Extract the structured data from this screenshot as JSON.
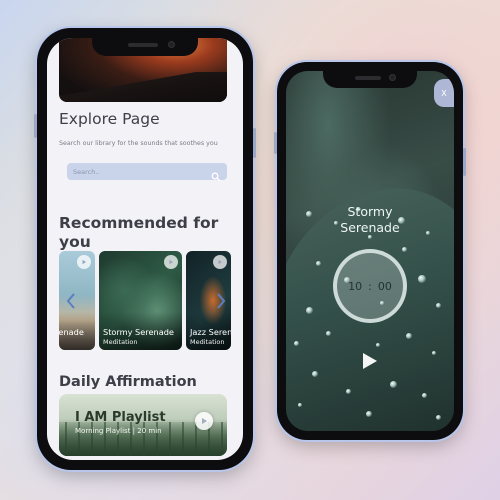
{
  "explore": {
    "title": "Explore Page",
    "subtitle": "Search our library for the sounds that soothes you",
    "search_placeholder": "Search.."
  },
  "recommended": {
    "title": "Recommended for you",
    "cards": [
      {
        "title": "Serenade",
        "category": ""
      },
      {
        "title": "Stormy Serenade",
        "category": "Meditation"
      },
      {
        "title": "Jazz Serenade",
        "category": "Meditation"
      }
    ]
  },
  "affirmation": {
    "title": "Daily Affirmation",
    "playlist_name": "I AM Playlist",
    "playlist_sub": "Morning Playlist | 20 min"
  },
  "player": {
    "close_label": "X",
    "title_line1": "Stormy",
    "title_line2": "Serenade",
    "minutes": "10",
    "seconds": "00"
  },
  "colors": {
    "frame": "#0d0d0f",
    "search_bg": "#c9d3ea",
    "text_dark": "#3e3e48",
    "close_btn": "#aeb8d6"
  },
  "icons": [
    "search-icon",
    "play-icon",
    "chevron-left-icon",
    "chevron-right-icon",
    "close-icon"
  ]
}
